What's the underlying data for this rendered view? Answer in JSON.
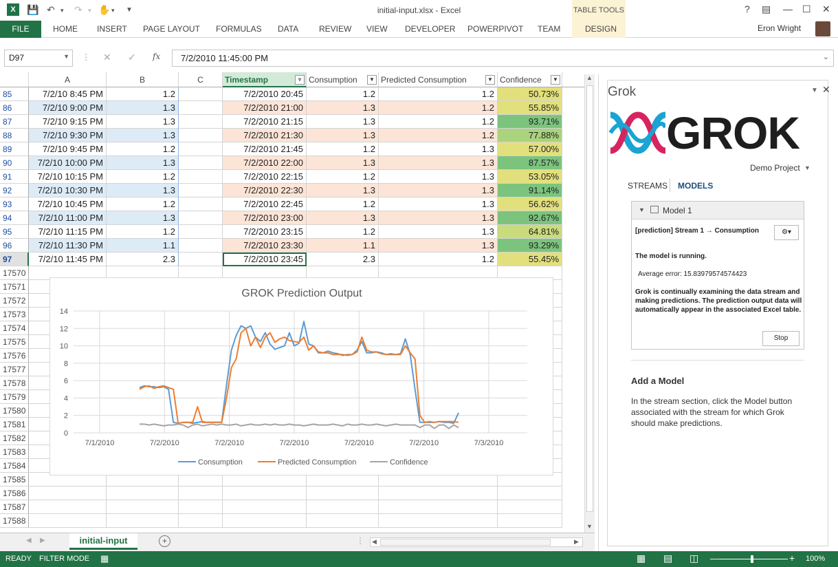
{
  "window": {
    "title": "initial-input.xlsx - Excel",
    "app_icon": "X",
    "help_label": "?"
  },
  "ribbon": {
    "file_tab": "FILE",
    "tabs": [
      "HOME",
      "INSERT",
      "PAGE LAYOUT",
      "FORMULAS",
      "DATA",
      "REVIEW",
      "VIEW",
      "DEVELOPER",
      "POWERPIVOT",
      "TEAM",
      "DESIGN"
    ],
    "context_group": "TABLE TOOLS",
    "user_name": "Eron Wright"
  },
  "formula_bar": {
    "name_box": "D97",
    "fx_label": "fx",
    "value": "7/2/2010  11:45:00 PM"
  },
  "sheet": {
    "columns": {
      "a": "A",
      "b": "B",
      "c": "C",
      "d": "Timestamp",
      "e": "Consumption",
      "f": "Predicted Consumption",
      "g": "Confidence"
    },
    "rows": [
      {
        "num": "85",
        "a": "7/2/10 8:45 PM",
        "b": "1.2",
        "d": "7/2/2010 20:45",
        "e": "1.2",
        "f": "1.2",
        "g": "50.73%"
      },
      {
        "num": "86",
        "a": "7/2/10 9:00 PM",
        "b": "1.3",
        "d": "7/2/2010 21:00",
        "e": "1.3",
        "f": "1.2",
        "g": "55.85%"
      },
      {
        "num": "87",
        "a": "7/2/10 9:15 PM",
        "b": "1.3",
        "d": "7/2/2010 21:15",
        "e": "1.3",
        "f": "1.2",
        "g": "93.71%"
      },
      {
        "num": "88",
        "a": "7/2/10 9:30 PM",
        "b": "1.3",
        "d": "7/2/2010 21:30",
        "e": "1.3",
        "f": "1.2",
        "g": "77.88%"
      },
      {
        "num": "89",
        "a": "7/2/10 9:45 PM",
        "b": "1.2",
        "d": "7/2/2010 21:45",
        "e": "1.2",
        "f": "1.3",
        "g": "57.00%"
      },
      {
        "num": "90",
        "a": "7/2/10 10:00 PM",
        "b": "1.3",
        "d": "7/2/2010 22:00",
        "e": "1.3",
        "f": "1.3",
        "g": "87.57%"
      },
      {
        "num": "91",
        "a": "7/2/10 10:15 PM",
        "b": "1.2",
        "d": "7/2/2010 22:15",
        "e": "1.2",
        "f": "1.3",
        "g": "53.05%"
      },
      {
        "num": "92",
        "a": "7/2/10 10:30 PM",
        "b": "1.3",
        "d": "7/2/2010 22:30",
        "e": "1.3",
        "f": "1.3",
        "g": "91.14%"
      },
      {
        "num": "93",
        "a": "7/2/10 10:45 PM",
        "b": "1.2",
        "d": "7/2/2010 22:45",
        "e": "1.2",
        "f": "1.3",
        "g": "56.62%"
      },
      {
        "num": "94",
        "a": "7/2/10 11:00 PM",
        "b": "1.3",
        "d": "7/2/2010 23:00",
        "e": "1.3",
        "f": "1.3",
        "g": "92.67%"
      },
      {
        "num": "95",
        "a": "7/2/10 11:15 PM",
        "b": "1.2",
        "d": "7/2/2010 23:15",
        "e": "1.2",
        "f": "1.3",
        "g": "64.81%"
      },
      {
        "num": "96",
        "a": "7/2/10 11:30 PM",
        "b": "1.1",
        "d": "7/2/2010 23:30",
        "e": "1.1",
        "f": "1.3",
        "g": "93.29%"
      },
      {
        "num": "97",
        "a": "7/2/10 11:45 PM",
        "b": "2.3",
        "d": "7/2/2010 23:45",
        "e": "2.3",
        "f": "1.2",
        "g": "55.45%"
      }
    ],
    "extra_rows": [
      "17570",
      "17571",
      "17572",
      "17573",
      "17574",
      "17575",
      "17576",
      "17577",
      "17578",
      "17579",
      "17580",
      "17581",
      "17582",
      "17583",
      "17584",
      "17585",
      "17586",
      "17587",
      "17588"
    ],
    "tab_name": "initial-input",
    "colors": {
      "row_blue": "#ddebf7",
      "row_peach": "#fce4d6",
      "conf_green": "#7cc47e",
      "conf_yellow": "#e2e07c",
      "accent": "#217346"
    }
  },
  "chart_data": {
    "type": "line",
    "title": "GROK Prediction Output",
    "x_tick_labels": [
      "7/1/2010",
      "7/2/2010",
      "7/2/2010",
      "7/2/2010",
      "7/2/2010",
      "7/2/2010",
      "7/3/2010"
    ],
    "ylim": [
      0,
      14
    ],
    "y_ticks": [
      0,
      2,
      4,
      6,
      8,
      10,
      12,
      14
    ],
    "grid": true,
    "legend_position": "bottom",
    "series": [
      {
        "name": "Consumption",
        "color": "#5b9bd5",
        "values": [
          [
            5.2,
            5.4,
            5.3,
            5.3,
            5.2,
            5.3,
            5.0,
            1.2,
            1.1,
            1.2,
            1.2,
            1.1,
            1.2,
            1.3,
            1.2,
            1.2,
            1.2,
            1.2,
            5.5,
            9.5,
            11.2,
            12.3,
            12.0,
            12.3,
            11.0,
            10.5,
            11.5,
            10.2,
            9.6,
            9.8,
            10.0,
            11.5,
            10.0,
            10.3,
            12.8,
            10.2,
            10.0,
            9.2,
            9.2,
            9.4,
            9.2,
            9.1,
            8.9,
            9.0,
            9.0,
            9.5,
            10.5,
            9.2,
            9.2,
            9.3,
            9.2,
            9.0,
            9.0,
            9.0,
            9.1,
            10.8,
            9.0,
            5.0,
            1.2,
            1.2,
            1.2,
            1.2,
            1.3,
            1.2,
            1.2,
            1.1,
            2.3
          ]
        ]
      },
      {
        "name": "Predicted Consumption",
        "color": "#ed7d31",
        "values": [
          [
            5.0,
            5.3,
            5.4,
            5.1,
            5.3,
            5.4,
            5.2,
            5.0,
            1.1,
            1.2,
            1.2,
            1.2,
            3.0,
            1.2,
            1.2,
            1.2,
            1.2,
            1.2,
            4.0,
            7.5,
            8.5,
            11.5,
            12.0,
            10.0,
            11.0,
            9.8,
            11.0,
            11.5,
            10.4,
            10.8,
            11.0,
            10.6,
            10.5,
            10.4,
            11.0,
            9.5,
            10.0,
            9.3,
            9.2,
            9.2,
            9.0,
            9.0,
            9.0,
            8.9,
            9.0,
            9.3,
            11.0,
            9.5,
            9.3,
            9.3,
            9.1,
            9.0,
            9.1,
            9.0,
            9.0,
            10.0,
            9.2,
            8.5,
            2.0,
            1.2,
            1.3,
            1.2,
            1.3,
            1.3,
            1.3,
            1.3,
            1.2
          ]
        ]
      },
      {
        "name": "Confidence",
        "color": "#a5a5a5",
        "values": [
          [
            1.0,
            1.0,
            0.9,
            1.0,
            0.9,
            0.8,
            0.9,
            0.9,
            1.0,
            0.9,
            0.6,
            0.9,
            1.0,
            0.8,
            0.9,
            1.0,
            0.9,
            1.0,
            0.9,
            0.9,
            1.0,
            0.8,
            0.9,
            1.0,
            0.9,
            0.9,
            1.0,
            0.9,
            1.0,
            0.9,
            0.9,
            1.0,
            0.9,
            0.9,
            0.8,
            0.9,
            1.0,
            0.9,
            0.9,
            0.9,
            1.0,
            0.9,
            0.8,
            1.0,
            0.9,
            0.9,
            1.0,
            0.9,
            0.9,
            1.0,
            0.9,
            0.8,
            0.9,
            1.0,
            0.9,
            0.9,
            0.9,
            0.9,
            0.6,
            0.9,
            0.9,
            0.5,
            0.9,
            0.9,
            0.5,
            0.9,
            0.6
          ]
        ]
      }
    ]
  },
  "pane": {
    "title": "Grok",
    "logo_text": "GROK",
    "project": "Demo Project",
    "tabs": [
      "STREAMS",
      "MODELS"
    ],
    "model": {
      "name": "Model 1",
      "stream_line": "[prediction] Stream 1  →  Consumption",
      "status": "The model is running.",
      "avg_error": "Average error:  15.83979574574423",
      "description": "Grok is continually examining the data stream and making predictions. The prediction output data will automatically appear in the associated Excel table.",
      "stop_label": "Stop"
    },
    "add_title": "Add a Model",
    "add_text": "In the stream section, click the Model button associated with the stream for which Grok should make predictions."
  },
  "status_bar": {
    "ready": "READY",
    "mode": "FILTER MODE",
    "zoom": "100%"
  }
}
